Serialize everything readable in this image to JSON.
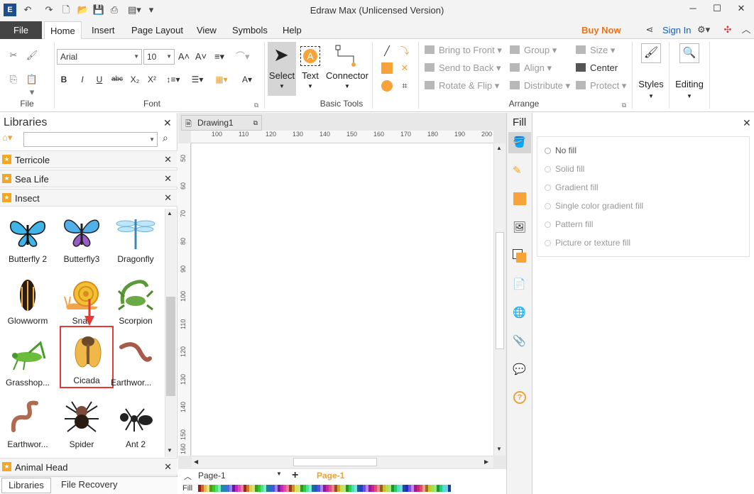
{
  "titlebar": {
    "title": "Edraw Max (Unlicensed Version)"
  },
  "tabs": {
    "file": "File",
    "items": [
      "Home",
      "Insert",
      "Page Layout",
      "View",
      "Symbols",
      "Help"
    ],
    "active": "Home",
    "buy_now": "Buy Now",
    "sign_in": "Sign In"
  },
  "ribbon": {
    "file_group": "File",
    "font_group": "Font",
    "font_name": "Arial",
    "font_size": "10",
    "basic_tools_group": "Basic Tools",
    "select": "Select",
    "text": "Text",
    "connector": "Connector",
    "arrange_group": "Arrange",
    "bring_to_front": "Bring to Front",
    "send_to_back": "Send to Back",
    "rotate_flip": "Rotate & Flip",
    "group": "Group",
    "align": "Align",
    "distribute": "Distribute",
    "size": "Size",
    "center": "Center",
    "protect": "Protect",
    "styles": "Styles",
    "editing": "Editing"
  },
  "libraries": {
    "title": "Libraries",
    "categories": [
      "Terricole",
      "Sea Life",
      "Insect"
    ],
    "shapes": [
      "Butterfly 2",
      "Butterfly3",
      "Dragonfly",
      "Glowworm",
      "Snail",
      "Scorpion",
      "Grasshop...",
      "Cicada",
      "Earthwor...",
      "Earthwor...",
      "Spider",
      "Ant 2"
    ],
    "bottom_category": "Animal Head",
    "tab_libraries": "Libraries",
    "tab_recovery": "File Recovery"
  },
  "canvas": {
    "doc_tab": "Drawing1",
    "ruler_h": [
      "100",
      "110",
      "120",
      "130",
      "140",
      "150",
      "160",
      "170",
      "180",
      "190",
      "200"
    ],
    "ruler_v": [
      "50",
      "60",
      "70",
      "80",
      "90",
      "100",
      "110",
      "120",
      "130",
      "140",
      "150",
      "160"
    ],
    "page_select": "Page-1",
    "page_active": "Page-1",
    "fill_label": "Fill"
  },
  "fill_panel": {
    "title": "Fill",
    "options": [
      "No fill",
      "Solid fill",
      "Gradient fill",
      "Single color gradient fill",
      "Pattern fill",
      "Picture or texture fill"
    ]
  },
  "colors": {
    "accent": "#e8731f",
    "link": "#1a5fb4",
    "highlight": "#e53935",
    "orange": "#f7a33a"
  }
}
